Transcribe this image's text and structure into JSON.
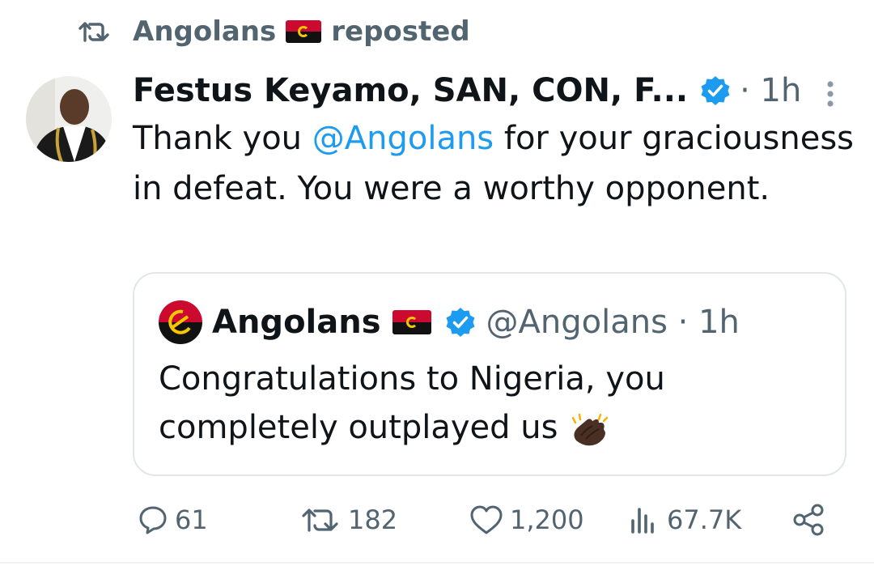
{
  "repost": {
    "user": "Angolans",
    "label": "reposted",
    "icon": "repost-icon"
  },
  "tweet": {
    "author_name": "Festus Keyamo, SAN, CON, F...",
    "time": "· 1h",
    "text_before": "Thank you ",
    "mention": "@Angolans",
    "text_after": " for your graciousness in defeat. You were a worthy opponent."
  },
  "quote": {
    "name": "Angolans",
    "handle": "@Angolans · 1h",
    "text": "Congratulations to Nigeria, you completely outplayed us"
  },
  "actions": {
    "replies": "61",
    "reposts": "182",
    "likes": "1,200",
    "views": "67.7K"
  },
  "colors": {
    "accent": "#1d9bf0",
    "muted": "#536471",
    "text": "#0f1419",
    "flag_red": "#cc092f",
    "flag_black": "#111111",
    "flag_yellow": "#f7c600"
  }
}
